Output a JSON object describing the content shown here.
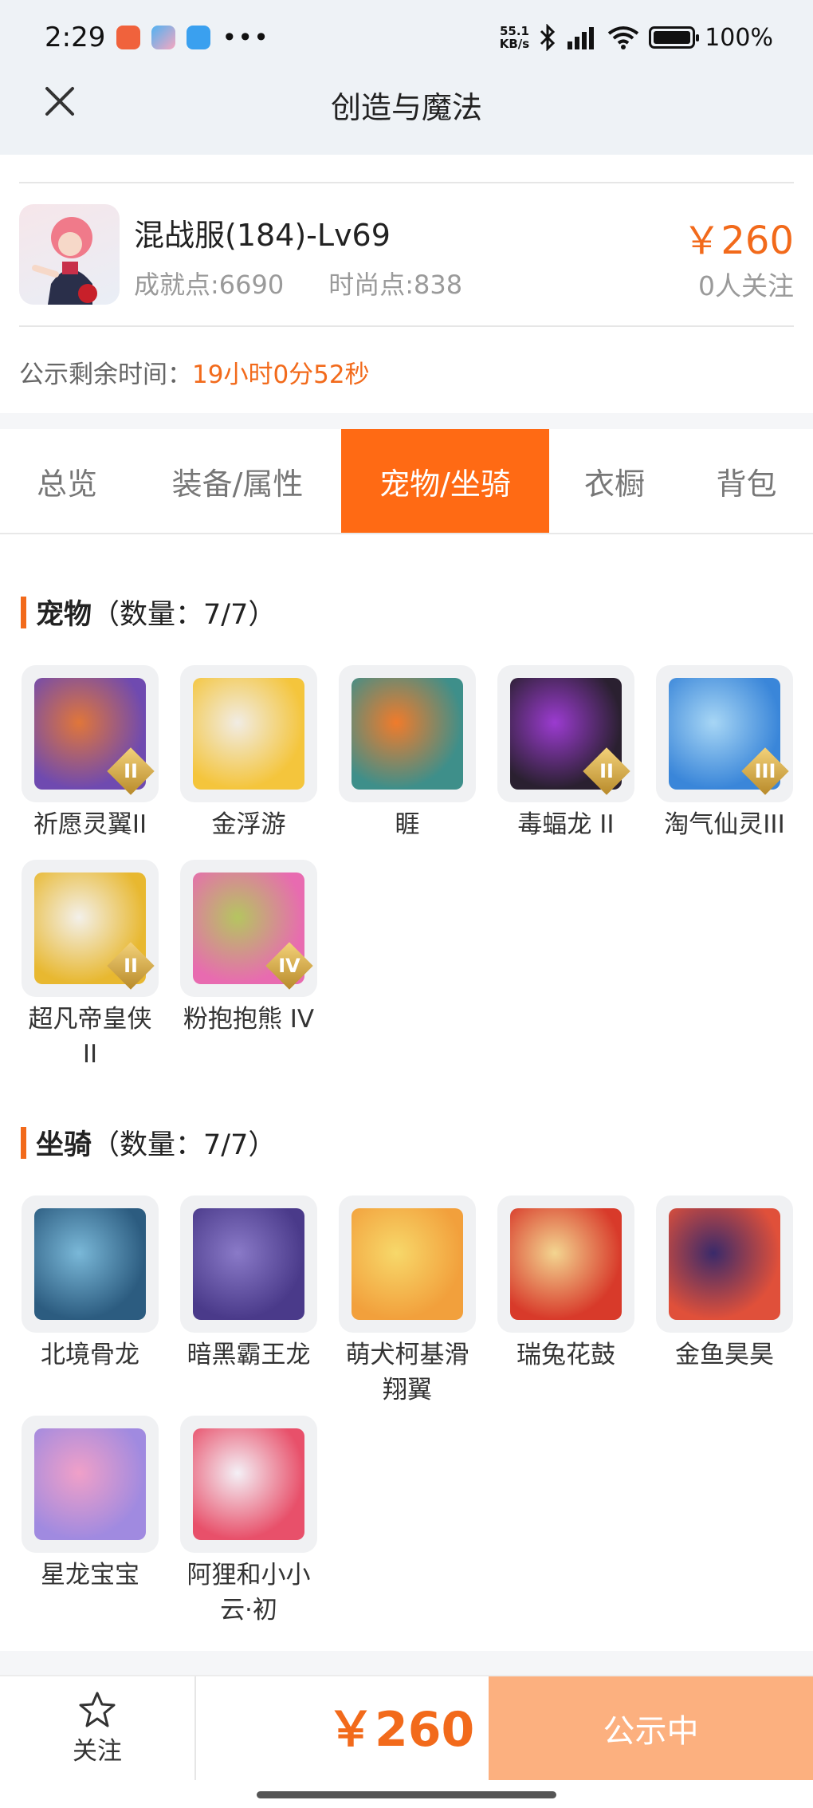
{
  "status_bar": {
    "time": "2:29",
    "net_speed_value": "55.1",
    "net_speed_unit": "KB/s",
    "battery": "100%",
    "icons": [
      "app-icon-red",
      "app-icon-game",
      "app-icon-blue",
      "more-dots",
      "bluetooth-icon",
      "signal-icon",
      "wifi-icon",
      "battery-icon"
    ]
  },
  "header": {
    "title": "创造与魔法",
    "close_icon": "close-icon"
  },
  "account": {
    "server": "混战服(184)-Lv69",
    "achievement": "成就点:6690",
    "fashion": "时尚点:838",
    "price": "￥260",
    "followers": "0人关注",
    "remain_label": "公示剩余时间：",
    "remain_time": "19小时0分52秒"
  },
  "tabs": [
    {
      "label": "总览",
      "active": false
    },
    {
      "label": "装备/属性",
      "active": false
    },
    {
      "label": "宠物/坐骑",
      "active": true
    },
    {
      "label": "衣橱",
      "active": false
    },
    {
      "label": "背包",
      "active": false
    }
  ],
  "pets": {
    "title": "宠物",
    "count": "（数量：7/7）",
    "items": [
      {
        "name": "祈愿灵翼II",
        "badge": "II",
        "colors": [
          "#6f4ab0",
          "#e0763a"
        ]
      },
      {
        "name": "金浮游",
        "badge": "",
        "colors": [
          "#f4c53c",
          "#f1ece4"
        ]
      },
      {
        "name": "睚",
        "badge": "",
        "colors": [
          "#3e8f8a",
          "#f07b2b"
        ]
      },
      {
        "name": "毒蝠龙 II",
        "badge": "II",
        "colors": [
          "#2a2030",
          "#9b3bd0"
        ]
      },
      {
        "name": "淘气仙灵III",
        "badge": "III",
        "colors": [
          "#3a86d9",
          "#a7d6f5"
        ]
      },
      {
        "name": "超凡帝皇侠II",
        "badge": "II",
        "colors": [
          "#e8b830",
          "#f3f0ea"
        ]
      },
      {
        "name": "粉抱抱熊 IV",
        "badge": "IV",
        "colors": [
          "#e86bb0",
          "#b5c560"
        ]
      }
    ]
  },
  "mounts": {
    "title": "坐骑",
    "count": "（数量：7/7）",
    "items": [
      {
        "name": "北境骨龙",
        "badge": "",
        "colors": [
          "#2c5c80",
          "#7ab8d8"
        ]
      },
      {
        "name": "暗黑霸王龙",
        "badge": "",
        "colors": [
          "#4a3a8a",
          "#8a7ac8"
        ]
      },
      {
        "name": "萌犬柯基滑翔翼",
        "badge": "",
        "colors": [
          "#f2a03c",
          "#f7d86a"
        ]
      },
      {
        "name": "瑞兔花鼓",
        "badge": "",
        "colors": [
          "#d83a2a",
          "#f3d590"
        ]
      },
      {
        "name": "金鱼昊昊",
        "badge": "",
        "colors": [
          "#e0503a",
          "#3a2a6a"
        ]
      },
      {
        "name": "星龙宝宝",
        "badge": "",
        "colors": [
          "#a08ae0",
          "#f0a0c8"
        ]
      },
      {
        "name": "阿狸和小小云·初",
        "badge": "",
        "colors": [
          "#e8506a",
          "#f4f0f6"
        ]
      }
    ]
  },
  "bottom_bar": {
    "follow_label": "关注",
    "price": "￥260",
    "cta_label": "公示中"
  }
}
